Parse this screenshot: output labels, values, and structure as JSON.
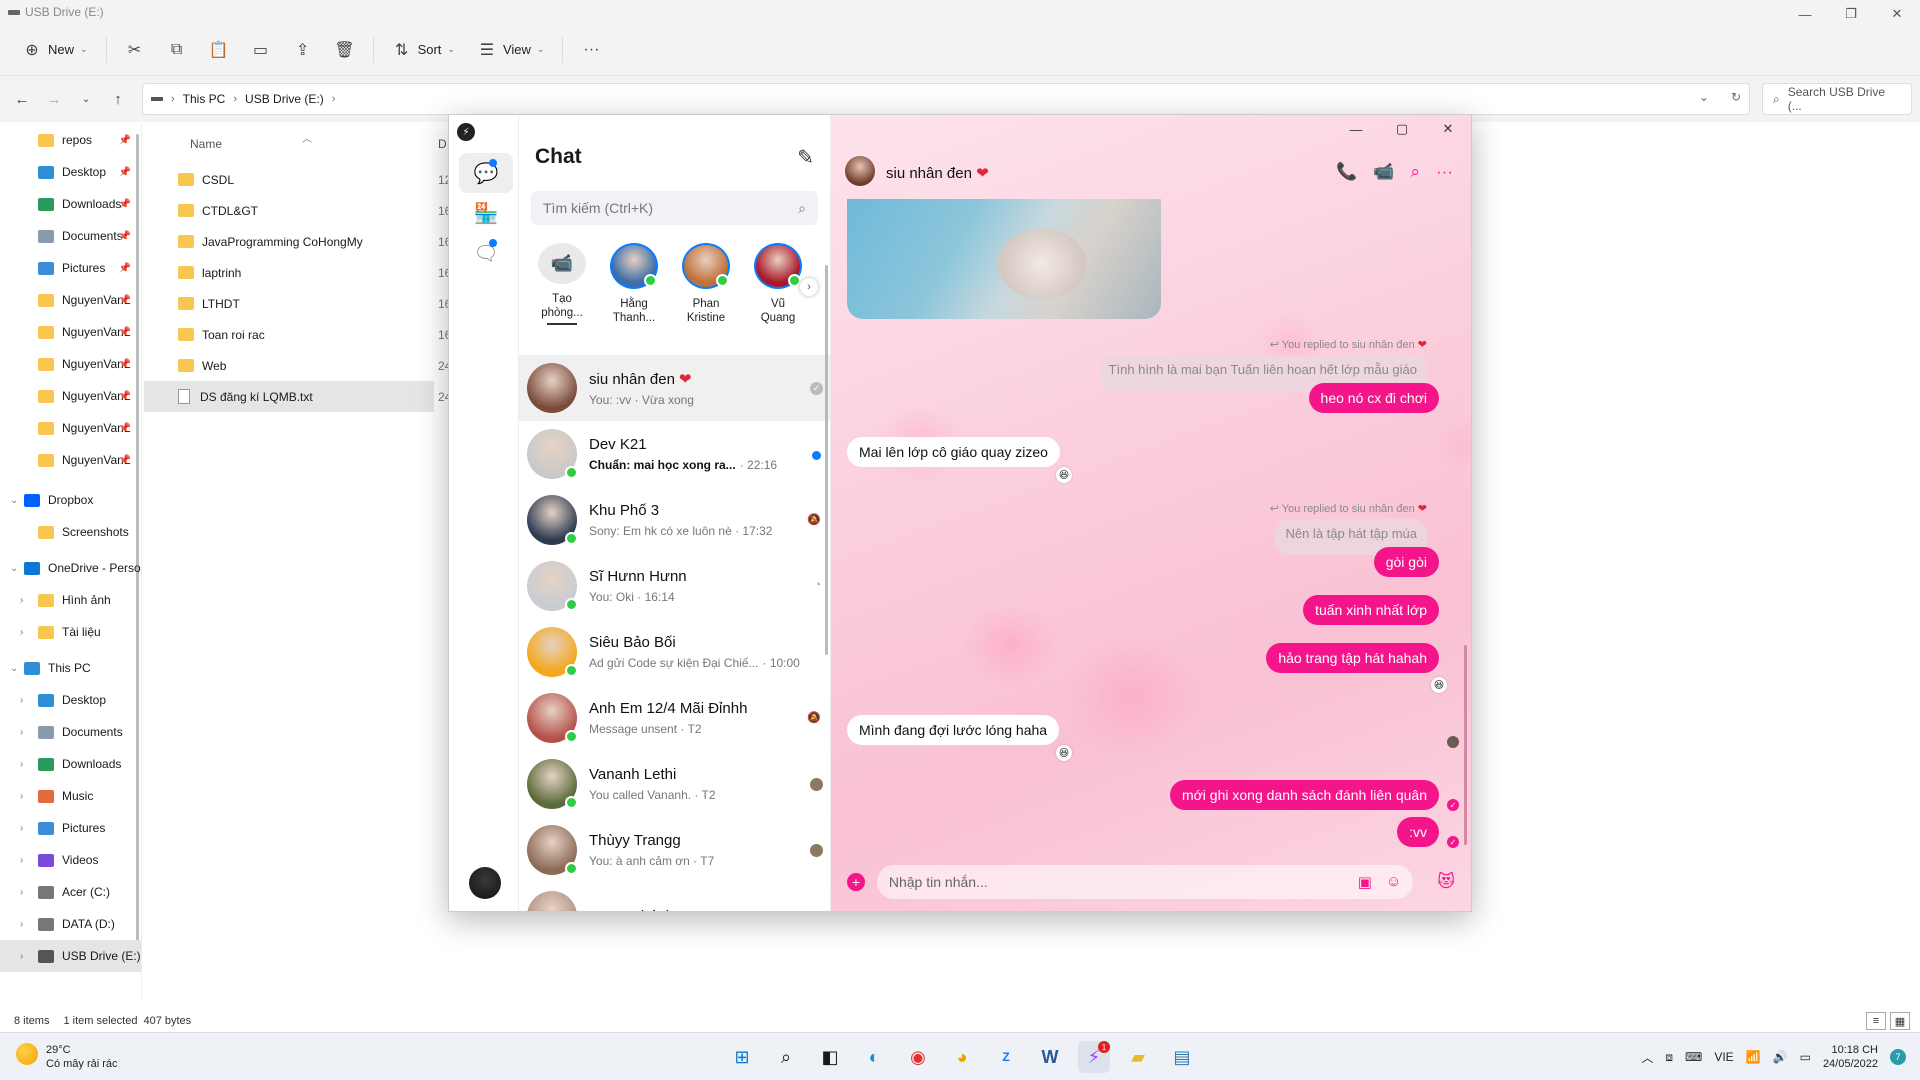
{
  "explorer": {
    "title": "USB Drive (E:)",
    "toolbar": {
      "new": "New",
      "sort": "Sort",
      "view": "View"
    },
    "breadcrumb": [
      "This PC",
      "USB Drive (E:)"
    ],
    "search_placeholder": "Search USB Drive (...",
    "nav": [
      {
        "label": "repos",
        "icon": "folder-icon",
        "pinned": true
      },
      {
        "label": "Desktop",
        "icon": "desktop-icon",
        "pinned": true
      },
      {
        "label": "Downloads",
        "icon": "download-icon",
        "pinned": true
      },
      {
        "label": "Documents",
        "icon": "documents-icon",
        "pinned": true
      },
      {
        "label": "Pictures",
        "icon": "pictures-icon",
        "pinned": true
      },
      {
        "label": "NguyenVanL",
        "icon": "folder-icon",
        "pinned": true
      },
      {
        "label": "NguyenVanL",
        "icon": "folder-icon",
        "pinned": true
      },
      {
        "label": "NguyenVanL",
        "icon": "folder-icon",
        "pinned": true
      },
      {
        "label": "NguyenVanL",
        "icon": "folder-icon",
        "pinned": true
      },
      {
        "label": "NguyenVanL",
        "icon": "folder-icon",
        "pinned": true
      },
      {
        "label": "NguyenVanL",
        "icon": "folder-icon",
        "pinned": true
      },
      {
        "label": "Dropbox",
        "icon": "dropbox-icon",
        "pinned": false
      },
      {
        "label": "Screenshots",
        "icon": "folder-icon",
        "pinned": false
      },
      {
        "label": "OneDrive - Perso",
        "icon": "onedrive-icon",
        "pinned": false
      },
      {
        "label": "Hình ảnh",
        "icon": "folder-icon",
        "pinned": false
      },
      {
        "label": "Tài liệu",
        "icon": "folder-icon",
        "pinned": false
      },
      {
        "label": "This PC",
        "icon": "pc-icon",
        "pinned": false
      },
      {
        "label": "Desktop",
        "icon": "desktop-icon",
        "pinned": false
      },
      {
        "label": "Documents",
        "icon": "documents-icon",
        "pinned": false
      },
      {
        "label": "Downloads",
        "icon": "download-icon",
        "pinned": false
      },
      {
        "label": "Music",
        "icon": "music-icon",
        "pinned": false
      },
      {
        "label": "Pictures",
        "icon": "pictures-icon",
        "pinned": false
      },
      {
        "label": "Videos",
        "icon": "videos-icon",
        "pinned": false
      },
      {
        "label": "Acer (C:)",
        "icon": "drive-icon",
        "pinned": false
      },
      {
        "label": "DATA (D:)",
        "icon": "drive-icon",
        "pinned": false
      },
      {
        "label": "USB Drive (E:)",
        "icon": "usb-icon",
        "pinned": false
      }
    ],
    "column_name": "Name",
    "column_date": "D",
    "files": [
      {
        "name": "CSDL",
        "date": "12"
      },
      {
        "name": "CTDL&GT",
        "date": "16"
      },
      {
        "name": "JavaProgramming CoHongMy",
        "date": "16"
      },
      {
        "name": "laptrinh",
        "date": "16"
      },
      {
        "name": "LTHDT",
        "date": "16"
      },
      {
        "name": "Toan roi rac",
        "date": "16"
      },
      {
        "name": "Web",
        "date": "24"
      },
      {
        "name": "DS đăng kí LQMB.txt",
        "date": "24"
      }
    ],
    "status": {
      "items": "8 items",
      "selected": "1 item selected",
      "size": "407 bytes"
    }
  },
  "messenger": {
    "chat_title": "Chat",
    "search_placeholder": "Tìm kiếm (Ctrl+K)",
    "stories": [
      {
        "name": "Tạo phòng...",
        "icon": "video-camera-icon"
      },
      {
        "name": "Hằng Thanh...",
        "color": "#3d6ea8"
      },
      {
        "name": "Phan Kristine",
        "color": "#c0703a"
      },
      {
        "name": "Vũ Quang",
        "color": "#a8182a"
      }
    ],
    "conversations": [
      {
        "name": "siu nhân đen",
        "heart": "❤",
        "preview": "You: :vv · Vừa xong",
        "color": "#7a4a3a"
      },
      {
        "name": "Dev K21",
        "preview": "Chuẩn: mai học xong ra...",
        "time": "· 22:16",
        "color": "#c9c9c9"
      },
      {
        "name": "Khu Phố 3",
        "preview": "Sony: Em hk có xe luôn nè · 17:32",
        "color": "#2d3a52"
      },
      {
        "name": "Sĩ Hưnn Hưnn",
        "preview": "You: Oki · 16:14",
        "color": "#c8ccd2"
      },
      {
        "name": "Siêu Bảo Bối",
        "preview": "Ad gửi Code sự kiện Đại Chiế...",
        "time": "· 10:00",
        "color": "#f2a81a"
      },
      {
        "name": "Anh Em 12/4 Mãi Đỉnhh",
        "preview": "Message unsent · T2",
        "color": "#b4504a"
      },
      {
        "name": "Vananh Lethi",
        "preview": "You called Vananh. · T2",
        "color": "#5a6a3a"
      },
      {
        "name": "Thùyy Trangg",
        "preview": "You: à anh cảm ơn · T7",
        "color": "#8b6b58"
      },
      {
        "name": "Hưng Khánh",
        "preview": "",
        "color": "#b09080"
      }
    ],
    "chat": {
      "contact": "siu nhân đen",
      "reply_note_1": "You replied to siu nhân đen",
      "quoted_1": "Tình hình là mai bạn Tuấn liên hoan hết lớp mẫu giáo",
      "msg_1": "heo nó cx đi chơi",
      "msg_2": "Mai lên lớp cô giáo quay zizeo",
      "reply_note_2": "You replied to siu nhân đen",
      "quoted_2": "Nên là tập hát tập múa",
      "msg_3": "gòi gòi",
      "msg_4": "tuấn xinh nhất lớp",
      "msg_5": "hảo trang tập hát hahah",
      "msg_6": "Mình đang đợi lước lóng haha",
      "msg_7": "mới ghi xong danh sách đánh liên quân",
      "msg_8": ":vv",
      "composer_placeholder": "Nhập tin nhắn...",
      "accent": "#f5158a"
    }
  },
  "taskbar": {
    "temp": "29°C",
    "weather": "Có mây rải rác",
    "lang": "VIE",
    "time": "10:18 CH",
    "date": "24/05/2022",
    "notif_count": "7",
    "messenger_badge": "1"
  }
}
